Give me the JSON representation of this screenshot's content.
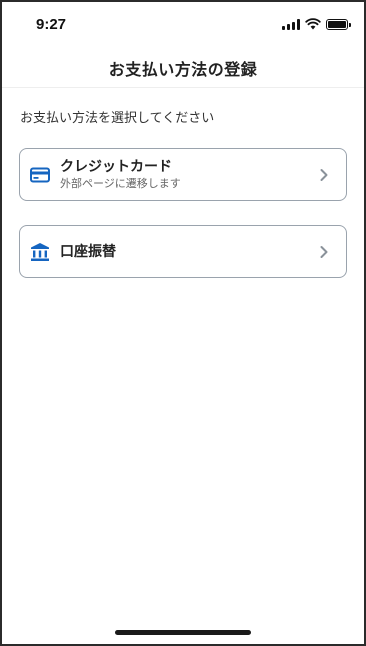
{
  "status_bar": {
    "time": "9:27"
  },
  "header": {
    "title": "お支払い方法の登録"
  },
  "instruction": "お支払い方法を選択してください",
  "options": [
    {
      "title": "クレジットカード",
      "subtitle": "外部ページに遷移します",
      "icon": "credit-card-icon"
    },
    {
      "title": "口座振替",
      "subtitle": "",
      "icon": "bank-icon"
    }
  ],
  "colors": {
    "accent": "#1565c0",
    "border": "#9aa3ad",
    "chevron": "#8a929a"
  }
}
